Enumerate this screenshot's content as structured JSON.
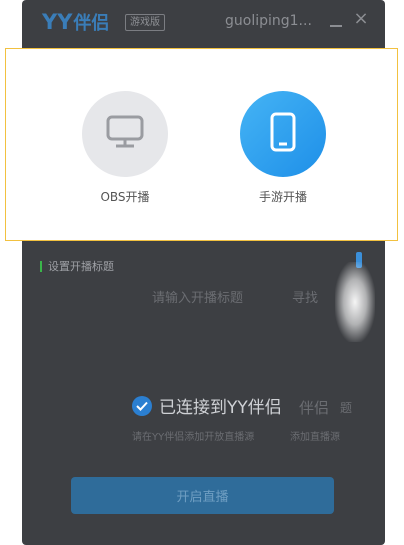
{
  "titlebar": {
    "logo_yy": "YY",
    "logo_cn": "伴侣",
    "edition_badge": "游戏版",
    "username": "guoliping1...",
    "close_symbol": "×"
  },
  "main": {
    "section_title": "设置开播标题",
    "title_placeholder": "请输入开播标题",
    "search_label": "寻找",
    "connected_text": "已连接到YY伴侣",
    "faded_partner_text": "伴侣",
    "faded_suffix": "题",
    "hint_text": "请在YY伴侣添加开放直播源",
    "hint_suffix": "添加直播源",
    "start_button": "开启直播"
  },
  "modes": {
    "obs_label": "OBS开播",
    "mobile_label": "手游开播"
  },
  "icons": {
    "obs": "monitor-icon",
    "mobile": "phone-icon",
    "connected": "check-circle-icon"
  },
  "colors": {
    "app_bg": "#3d3f43",
    "highlight_border": "#f2c140",
    "mobile_accent": "#2196f3",
    "start_button": "#2f6c9a"
  }
}
